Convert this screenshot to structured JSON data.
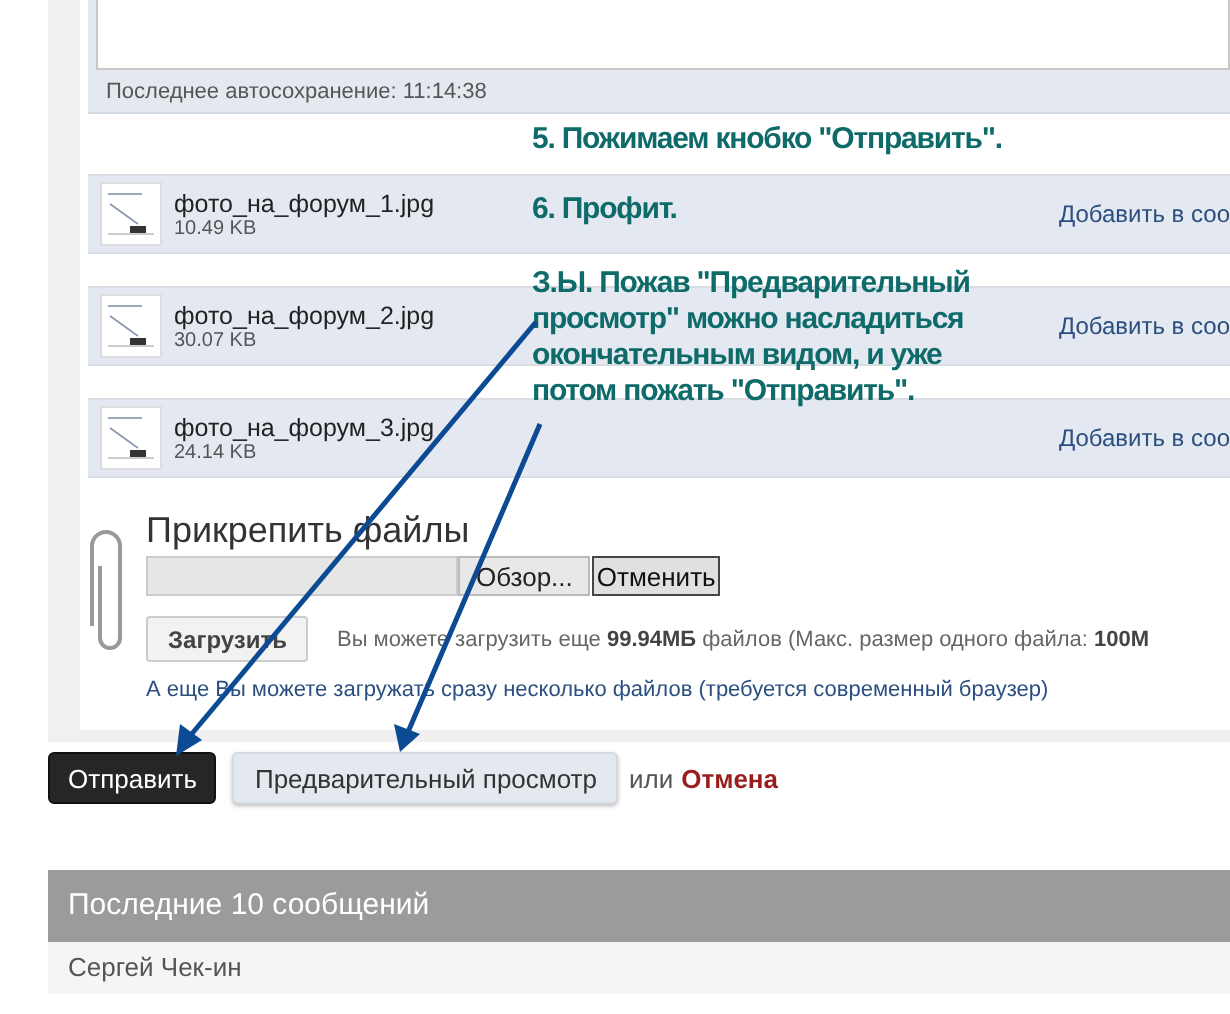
{
  "editor": {
    "autosave": "Последнее автосохранение: 11:14:38"
  },
  "attachments": [
    {
      "name": "фото_на_форум_1.jpg",
      "size": "10.49 KB",
      "action": "Добавить в соо"
    },
    {
      "name": "фото_на_форум_2.jpg",
      "size": "30.07 KB",
      "action": "Добавить в соо"
    },
    {
      "name": "фото_на_форум_3.jpg",
      "size": "24.14 KB",
      "action": "Добавить в соо"
    }
  ],
  "attach_files": {
    "title": "Прикрепить файлы",
    "browse": "Обзор...",
    "cancel": "Отменить",
    "upload": "Загрузить",
    "info": "Вы можете загрузить еще **99.94МБ** файлов (Макс. размер одного файла: **100М**",
    "multi_link": "А еще Вы можете загружать сразу несколько файлов (требуется современный браузер)"
  },
  "actions": {
    "submit": "Отправить",
    "preview": "Предварительный просмотр",
    "or": "или",
    "cancel": "Отмена"
  },
  "recent": {
    "title": "Последние 10 сообщений",
    "rows": [
      "Сергей Чек-ин"
    ]
  },
  "annotations": [
    {
      "text": "5. Пожимаем кнобко \"Отправить\"."
    },
    {
      "text": "6. Профит."
    },
    {
      "text": "З.Ы. Пожав \"Предварительный просмотр\" можно насладиться окончательным видом, и уже потом пожать \"Отправить\"."
    }
  ]
}
